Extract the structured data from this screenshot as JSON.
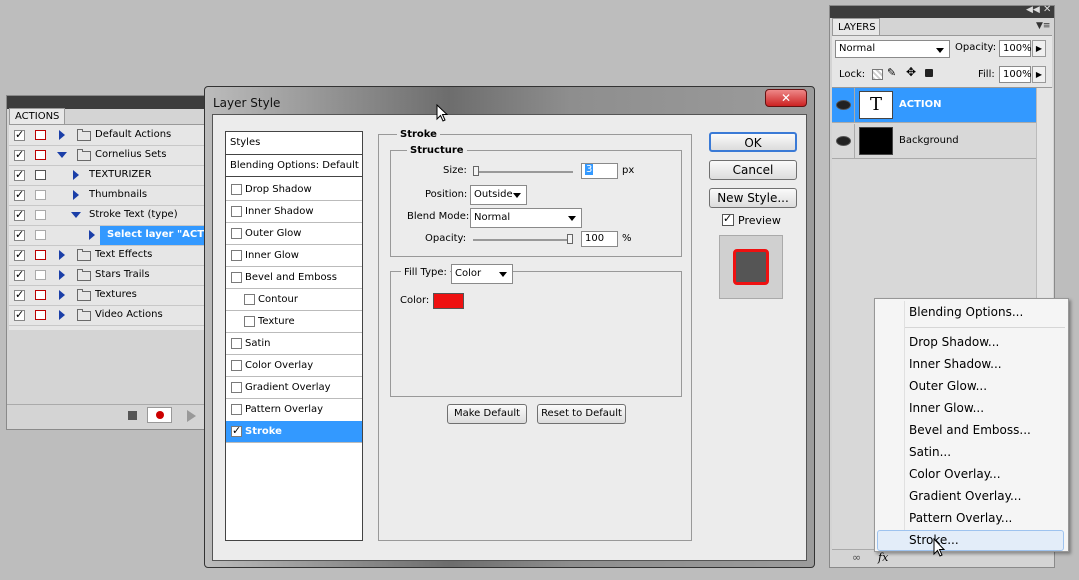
{
  "actions_panel": {
    "tab": "ACTIONS",
    "rows": [
      {
        "label": "Default Actions",
        "kind": "set"
      },
      {
        "label": "Cornelius Sets",
        "kind": "set-open"
      },
      {
        "label": "TEXTURIZER",
        "kind": "action"
      },
      {
        "label": "Thumbnails",
        "kind": "action"
      },
      {
        "label": "Stroke Text (type)",
        "kind": "action-open"
      },
      {
        "label": "Select layer \"ACTIO",
        "kind": "step-selected"
      },
      {
        "label": "Text Effects",
        "kind": "set"
      },
      {
        "label": "Stars Trails",
        "kind": "set"
      },
      {
        "label": "Textures",
        "kind": "set"
      },
      {
        "label": "Video Actions",
        "kind": "set"
      }
    ]
  },
  "dialog": {
    "title": "Layer Style",
    "styles_header": "Styles",
    "blending_item": "Blending Options: Default",
    "style_items": [
      {
        "label": "Drop Shadow",
        "checked": false,
        "indent": false
      },
      {
        "label": "Inner Shadow",
        "checked": false,
        "indent": false
      },
      {
        "label": "Outer Glow",
        "checked": false,
        "indent": false
      },
      {
        "label": "Inner Glow",
        "checked": false,
        "indent": false
      },
      {
        "label": "Bevel and Emboss",
        "checked": false,
        "indent": false
      },
      {
        "label": "Contour",
        "checked": false,
        "indent": true
      },
      {
        "label": "Texture",
        "checked": false,
        "indent": true
      },
      {
        "label": "Satin",
        "checked": false,
        "indent": false
      },
      {
        "label": "Color Overlay",
        "checked": false,
        "indent": false
      },
      {
        "label": "Gradient Overlay",
        "checked": false,
        "indent": false
      },
      {
        "label": "Pattern Overlay",
        "checked": false,
        "indent": false
      },
      {
        "label": "Stroke",
        "checked": true,
        "indent": false
      }
    ],
    "stroke": {
      "group_title": "Stroke",
      "structure_title": "Structure",
      "size_label": "Size:",
      "size_value": "3",
      "size_unit": "px",
      "size_slider_fraction": 0.0,
      "position_label": "Position:",
      "position_value": "Outside",
      "blend_label": "Blend Mode:",
      "blend_value": "Normal",
      "opacity_label": "Opacity:",
      "opacity_value": "100",
      "opacity_unit": "%",
      "opacity_slider_fraction": 1.0,
      "fill_type_label": "Fill Type:",
      "fill_type_value": "Color",
      "color_label": "Color:",
      "color_swatch": "#ee1111"
    },
    "make_default": "Make Default",
    "reset_default": "Reset to Default",
    "ok": "OK",
    "cancel": "Cancel",
    "new_style": "New Style...",
    "preview_label": "Preview",
    "preview_checked": true
  },
  "layers_panel": {
    "tab": "LAYERS",
    "blend_mode": "Normal",
    "opacity_label": "Opacity:",
    "opacity_value": "100%",
    "lock_label": "Lock:",
    "fill_label": "Fill:",
    "fill_value": "100%",
    "layers": [
      {
        "name": "ACTION",
        "thumb": "T",
        "selected": true
      },
      {
        "name": "Background",
        "thumb": "",
        "selected": false
      }
    ]
  },
  "context_menu": {
    "items": [
      "Blending Options...",
      "Drop Shadow...",
      "Inner Shadow...",
      "Outer Glow...",
      "Inner Glow...",
      "Bevel and Emboss...",
      "Satin...",
      "Color Overlay...",
      "Gradient Overlay...",
      "Pattern Overlay...",
      "Stroke..."
    ],
    "hovered_index": 10
  },
  "colors": {
    "selection_blue": "#3399ff",
    "stroke_red": "#ee1111",
    "dialog_bg": "#ececec"
  }
}
